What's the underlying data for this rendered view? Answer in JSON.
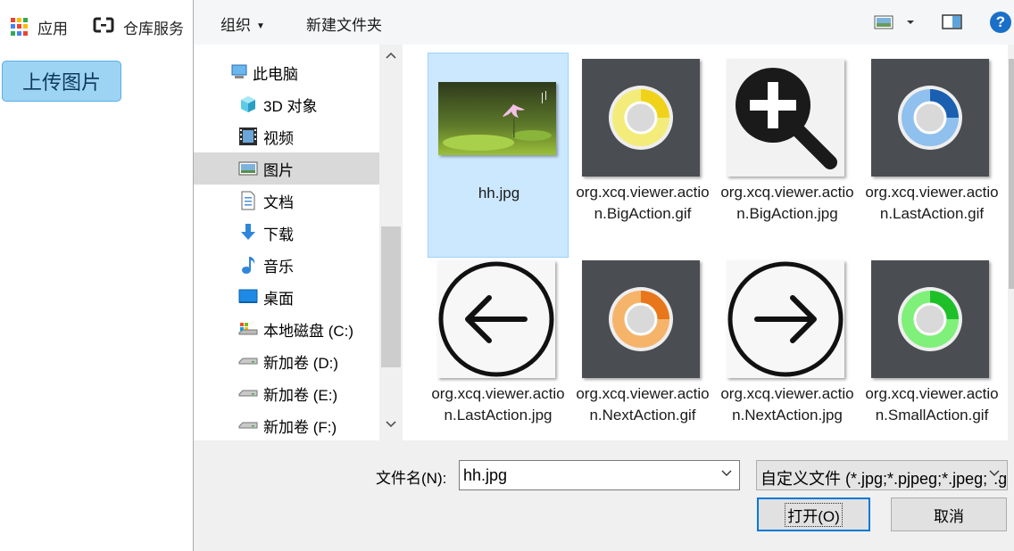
{
  "browser": {
    "bookmarks": [
      {
        "label": "应用",
        "icon": "apps-grid-icon"
      },
      {
        "label": "仓库服务",
        "icon": "cloud-link-icon"
      }
    ],
    "upload_button": "上传图片"
  },
  "dialog": {
    "toolbar": {
      "organize": "组织",
      "new_folder": "新建文件夹",
      "view_icon": "change-view-icon",
      "preview_icon": "preview-pane-icon",
      "help_icon": "help-icon",
      "help_glyph": "?"
    },
    "nav": [
      {
        "label": "此电脑",
        "icon": "this-pc-icon"
      },
      {
        "label": "3D 对象",
        "icon": "3d-objects-icon"
      },
      {
        "label": "视频",
        "icon": "videos-icon"
      },
      {
        "label": "图片",
        "icon": "pictures-icon",
        "selected": true
      },
      {
        "label": "文档",
        "icon": "documents-icon"
      },
      {
        "label": "下载",
        "icon": "downloads-icon"
      },
      {
        "label": "音乐",
        "icon": "music-icon"
      },
      {
        "label": "桌面",
        "icon": "desktop-icon"
      },
      {
        "label": "本地磁盘 (C:)",
        "icon": "local-disk-icon"
      },
      {
        "label": "新加卷 (D:)",
        "icon": "drive-icon"
      },
      {
        "label": "新加卷 (E:)",
        "icon": "drive-icon"
      },
      {
        "label": "新加卷 (F:)",
        "icon": "drive-icon"
      }
    ],
    "files": [
      {
        "name": "hh.jpg",
        "thumb": "lotus-photo",
        "selected": true
      },
      {
        "name": "org.xcq.viewer.action.BigAction.gif",
        "thumb": "spinner-yellow"
      },
      {
        "name": "org.xcq.viewer.action.BigAction.jpg",
        "thumb": "zoom-in"
      },
      {
        "name": "org.xcq.viewer.action.LastAction.gif",
        "thumb": "spinner-blue"
      },
      {
        "name": "org.xcq.viewer.action.LastAction.jpg",
        "thumb": "arrow-left"
      },
      {
        "name": "org.xcq.viewer.action.NextAction.gif",
        "thumb": "spinner-orange"
      },
      {
        "name": "org.xcq.viewer.action.NextAction.jpg",
        "thumb": "arrow-right"
      },
      {
        "name": "org.xcq.viewer.action.SmallAction.gif",
        "thumb": "spinner-green"
      }
    ],
    "filename_label": "文件名(N):",
    "filename_value": "hh.jpg",
    "filetype_value": "自定义文件 (*.jpg;*.pjpeg;*.jpeg;*.gif;*.png)",
    "open_button": "打开(O)",
    "cancel_button": "取消"
  },
  "colors": {
    "selection": "#cce8ff",
    "accent": "#0078d7",
    "upload_button": "#9dd4f4"
  }
}
